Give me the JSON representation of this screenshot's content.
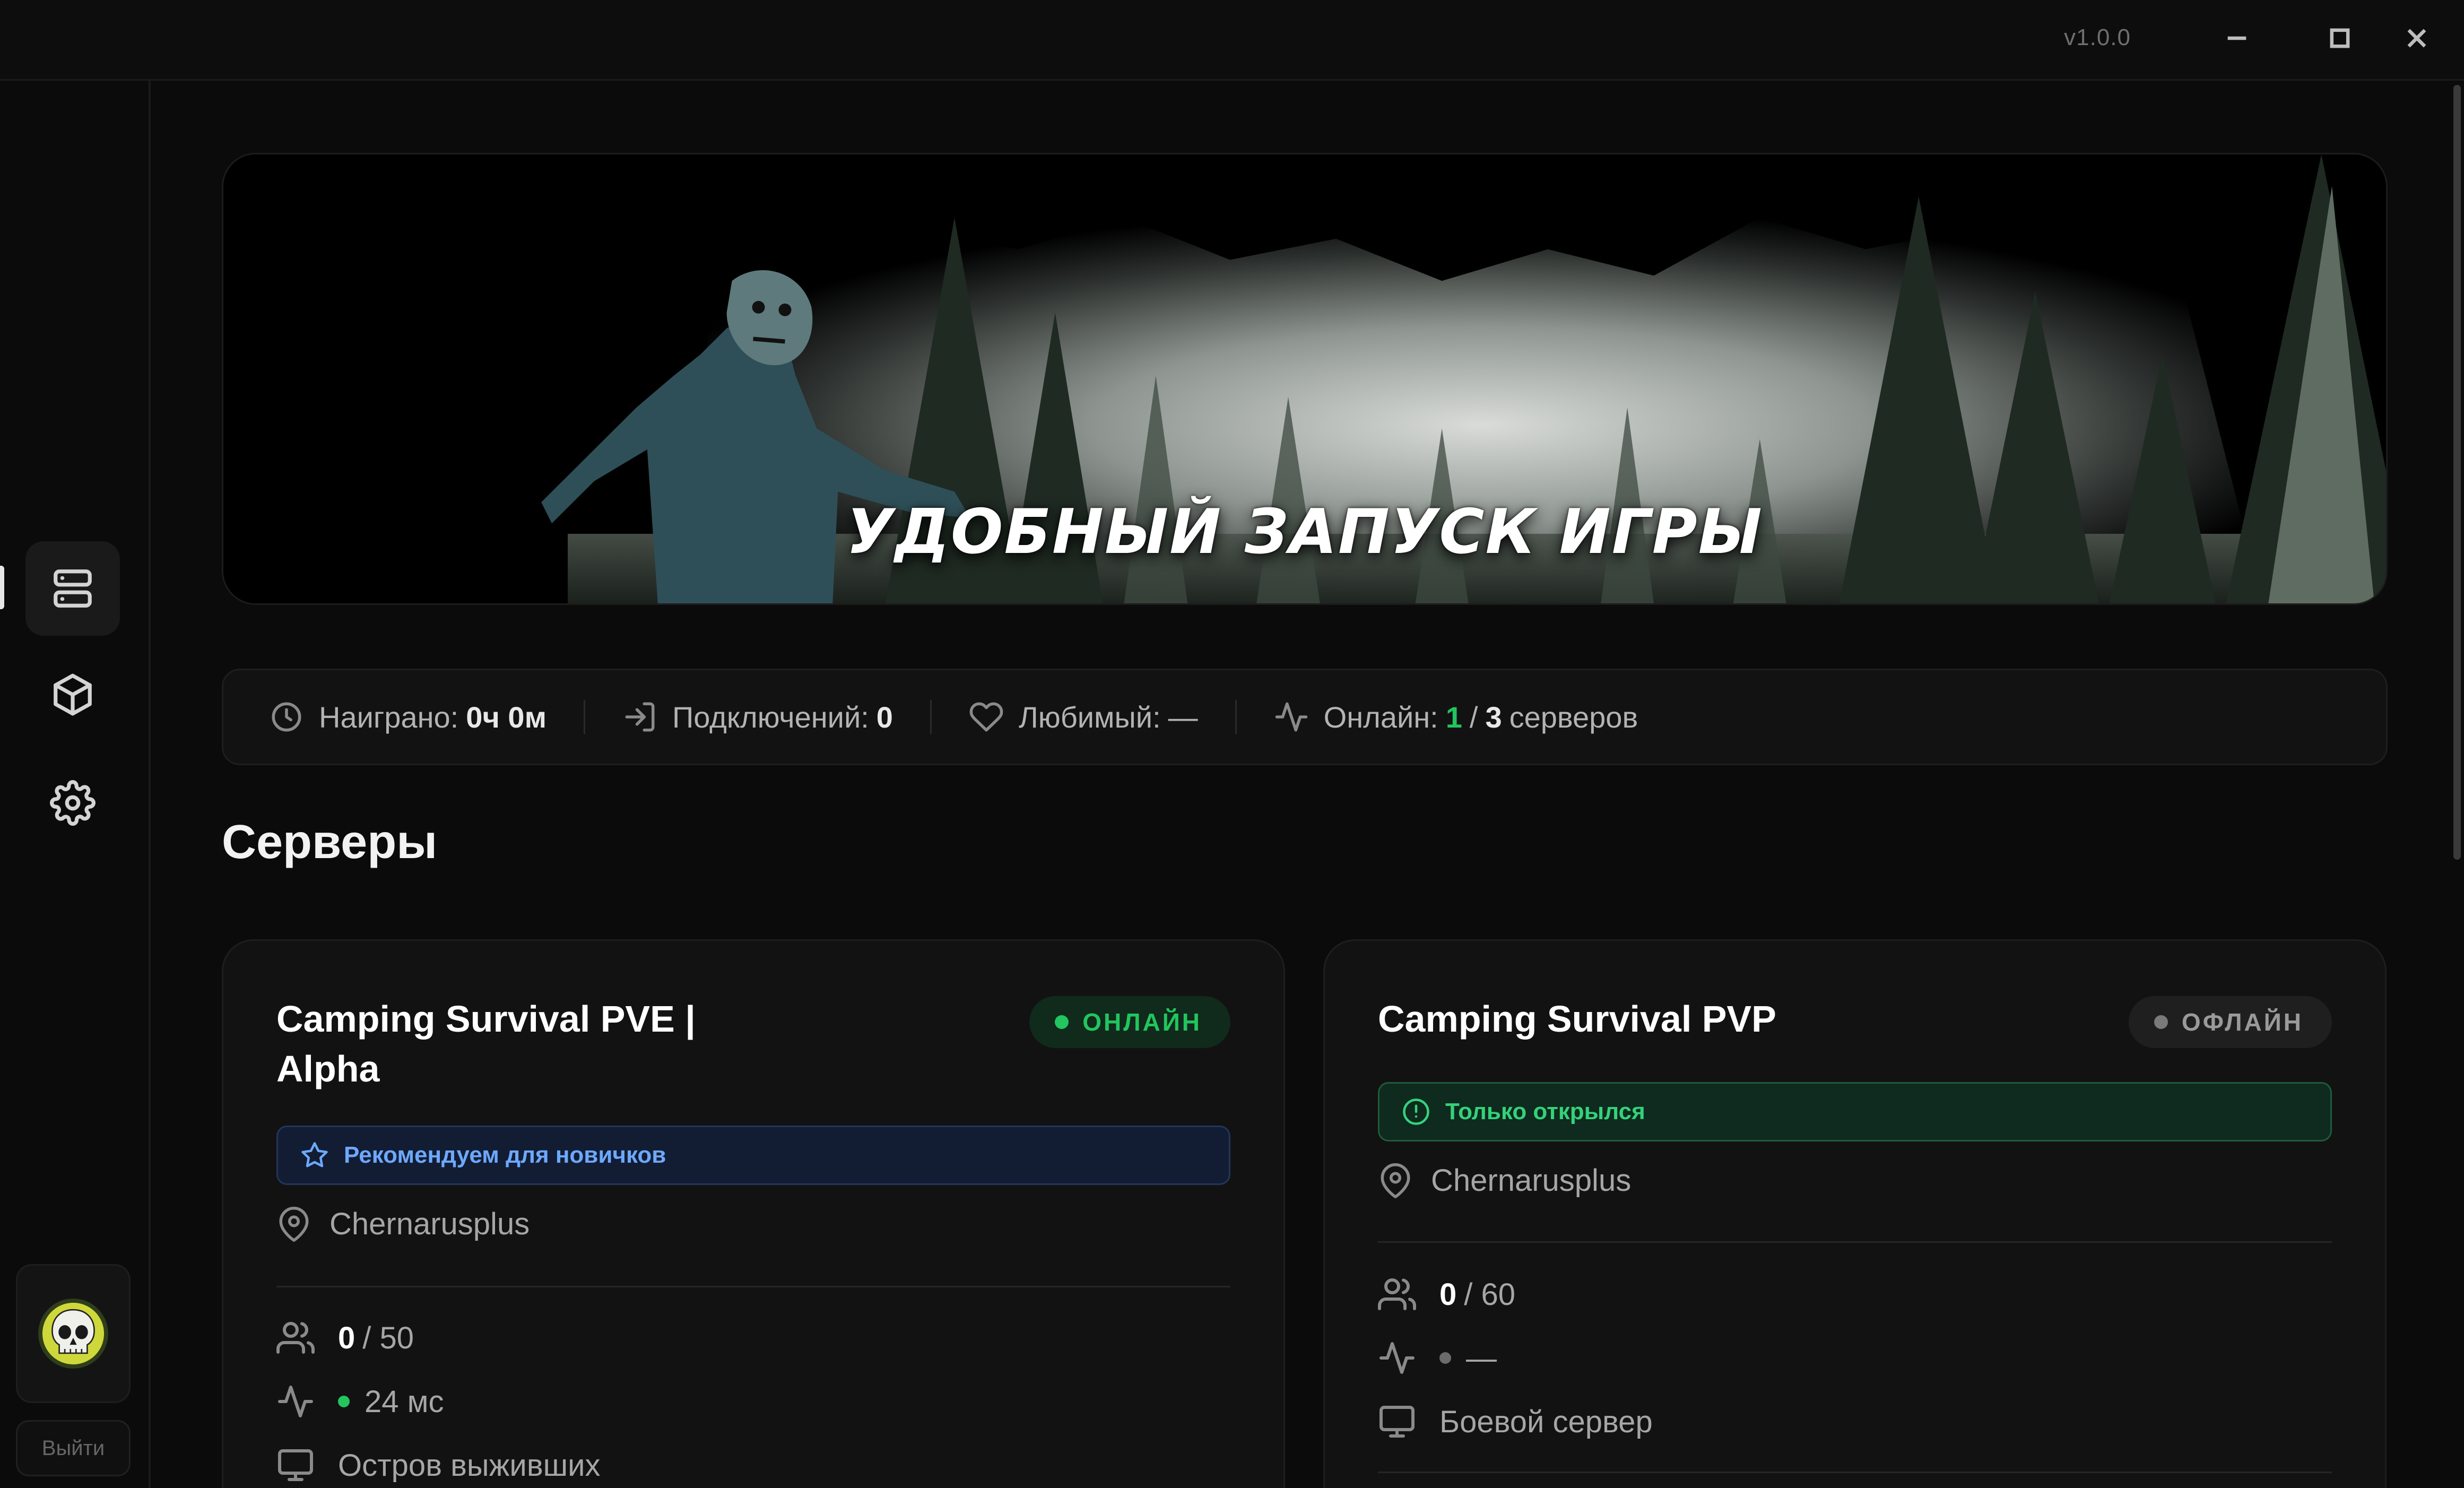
{
  "titlebar": {
    "version": "v1.0.0"
  },
  "sidebar": {
    "items": [
      {
        "name": "servers",
        "icon": "server-icon",
        "active": true
      },
      {
        "name": "mods",
        "icon": "package-icon",
        "active": false
      },
      {
        "name": "settings",
        "icon": "gear-icon",
        "active": false
      }
    ],
    "avatar_icon": "skull-avatar",
    "logout_label": "Выйти"
  },
  "banner": {
    "title": "УДОБНЫЙ ЗАПУСК ИГРЫ"
  },
  "stats": {
    "played_label": "Наиграно:",
    "played_value": "0ч 0м",
    "connections_label": "Подключений:",
    "connections_value": "0",
    "favorite_label": "Любимый:",
    "favorite_value": "—",
    "online_label": "Онлайн:",
    "online_value": "1",
    "online_sep": "/",
    "online_total": "3",
    "online_suffix": "серверов"
  },
  "section_title": "Серверы",
  "servers": [
    {
      "name": "Camping Survival PVE | Alpha",
      "status": "ОНЛАЙН",
      "status_color": "#22c55e",
      "tag": "Рекомендуем для новичков",
      "tag_icon": "star-icon",
      "map": "Chernarusplus",
      "players": "0",
      "players_max": "/ 50",
      "ping": "24 мс",
      "description": "Остров выживших"
    },
    {
      "name": "Camping Survival PVP",
      "status": "ОФЛАЙН",
      "status_color": "#7a7a7a",
      "tag": "Только открылся",
      "tag_icon": "info-circle-icon",
      "map": "Chernarusplus",
      "players": "0",
      "players_max": "/ 60",
      "ping": "—",
      "description": "Боевой сервер"
    }
  ],
  "colors": {
    "accent_green": "#22c55e",
    "accent_blue": "#6ea8ff",
    "background": "#0b0b0b"
  }
}
